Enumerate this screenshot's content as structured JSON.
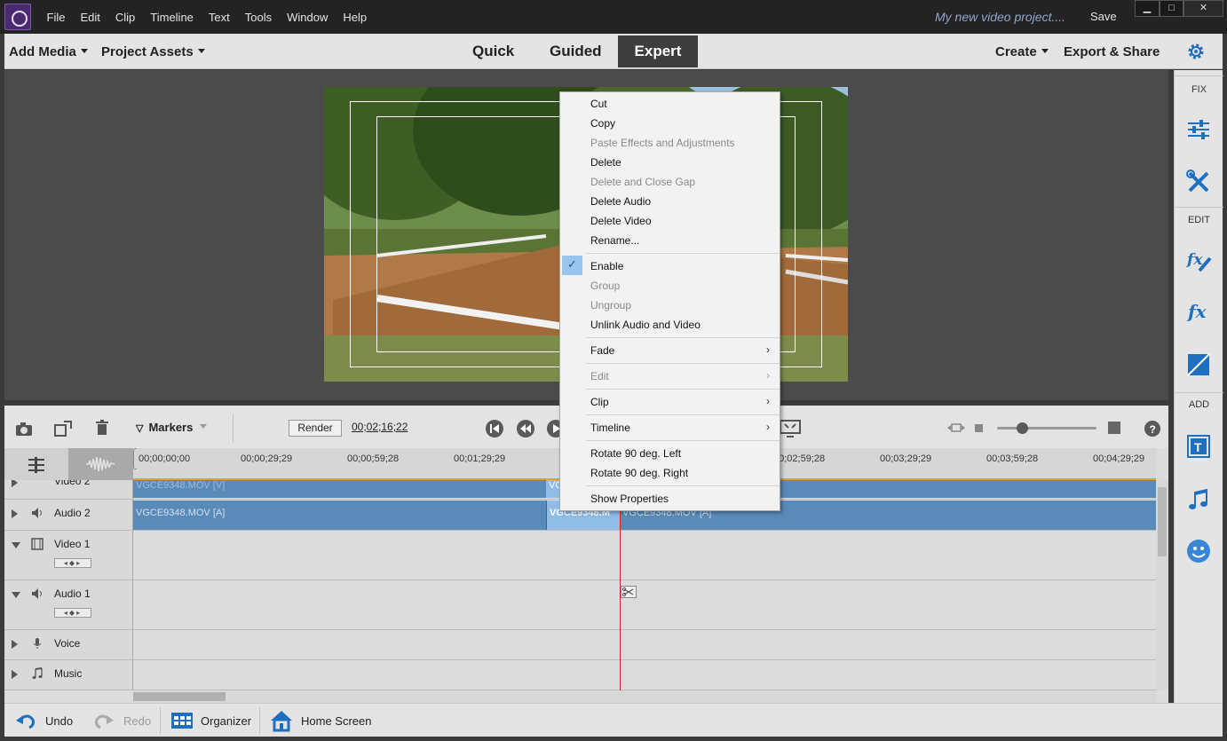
{
  "window": {
    "menu": [
      "File",
      "Edit",
      "Clip",
      "Timeline",
      "Text",
      "Tools",
      "Window",
      "Help"
    ],
    "project_title": "My new video project....",
    "save_label": "Save",
    "min": "▁",
    "max": "□",
    "close": "✕"
  },
  "topnav": {
    "add_media": "Add Media",
    "project_assets": "Project Assets",
    "modes": {
      "quick": "Quick",
      "guided": "Guided",
      "expert": "Expert"
    },
    "active_mode": "Expert",
    "create": "Create",
    "export_share": "Export & Share"
  },
  "right_panel": {
    "fix_label": "FIX",
    "edit_label": "EDIT",
    "add_label": "ADD",
    "icons": [
      "adjustments-icon",
      "tools-icon",
      "applied-effects-icon",
      "effects-icon",
      "transitions-icon",
      "titles-icon",
      "music-icon",
      "graphics-icon"
    ]
  },
  "timeline_toolbar": {
    "markers_label": "Markers",
    "render_label": "Render",
    "timecode": "00;02;16;22"
  },
  "ruler": {
    "ticks": [
      "00;00;00;00",
      "00;00;29;29",
      "00;00;59;28",
      "00;01;29;29",
      "00;02;59;28",
      "00;03;29;29",
      "00;03;59;28",
      "00;04;29;29"
    ]
  },
  "tracks": {
    "video2": {
      "name": "Video 2",
      "clip_a": "VGCE9348.MOV [V]",
      "clip_b": "VG"
    },
    "audio2": {
      "name": "Audio 2",
      "clip_a": "VGCE9348.MOV [A]",
      "clip_b": "VGCE9348.M",
      "clip_c": "VGCE9348.MOV [A]"
    },
    "video1": {
      "name": "Video 1"
    },
    "audio1": {
      "name": "Audio 1"
    },
    "voice": {
      "name": "Voice"
    },
    "music": {
      "name": "Music"
    },
    "keyframe_glyph": "◂◆▸"
  },
  "context_menu": {
    "cut": "Cut",
    "copy": "Copy",
    "paste_effects": "Paste Effects and Adjustments",
    "delete": "Delete",
    "delete_close_gap": "Delete and Close Gap",
    "delete_audio": "Delete Audio",
    "delete_video": "Delete Video",
    "rename": "Rename...",
    "enable": "Enable",
    "group": "Group",
    "ungroup": "Ungroup",
    "unlink": "Unlink Audio and Video",
    "fade": "Fade",
    "edit": "Edit",
    "clip": "Clip",
    "timeline": "Timeline",
    "rotate_left": "Rotate 90 deg. Left",
    "rotate_right": "Rotate 90 deg. Right",
    "show_properties": "Show Properties",
    "submenu_glyph": "›",
    "check_glyph": "✓"
  },
  "bottom_bar": {
    "undo": "Undo",
    "redo": "Redo",
    "organizer": "Organizer",
    "home_screen": "Home Screen"
  },
  "colors": {
    "clip": "#5a8ab8",
    "selected_clip": "#8fbde6",
    "playhead": "#e02020",
    "accent": "#1f6fc1"
  }
}
